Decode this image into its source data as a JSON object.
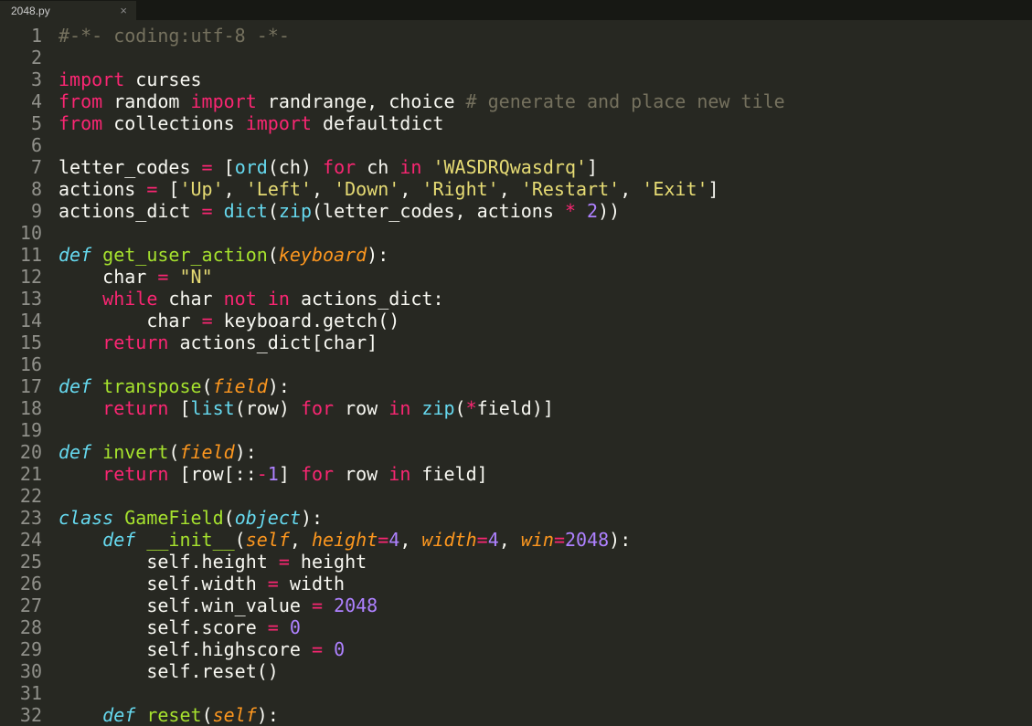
{
  "tab": {
    "filename": "2048.py",
    "close_glyph": "×"
  },
  "gutter": {
    "start": 1,
    "end": 32
  },
  "code": {
    "lines": [
      [
        {
          "cls": "c-comment",
          "t": "#-*- coding:utf-8 -*-"
        }
      ],
      [],
      [
        {
          "cls": "c-keyword",
          "t": "import"
        },
        {
          "cls": "c-name",
          "t": " curses"
        }
      ],
      [
        {
          "cls": "c-keyword",
          "t": "from"
        },
        {
          "cls": "c-name",
          "t": " random "
        },
        {
          "cls": "c-keyword",
          "t": "import"
        },
        {
          "cls": "c-name",
          "t": " randrange, choice "
        },
        {
          "cls": "c-comment",
          "t": "# generate and place new tile"
        }
      ],
      [
        {
          "cls": "c-keyword",
          "t": "from"
        },
        {
          "cls": "c-name",
          "t": " collections "
        },
        {
          "cls": "c-keyword",
          "t": "import"
        },
        {
          "cls": "c-name",
          "t": " defaultdict"
        }
      ],
      [],
      [
        {
          "cls": "c-name",
          "t": "letter_codes "
        },
        {
          "cls": "c-op",
          "t": "="
        },
        {
          "cls": "c-name",
          "t": " ["
        },
        {
          "cls": "c-builtin",
          "t": "ord"
        },
        {
          "cls": "c-name",
          "t": "(ch) "
        },
        {
          "cls": "c-keyword",
          "t": "for"
        },
        {
          "cls": "c-name",
          "t": " ch "
        },
        {
          "cls": "c-keyword",
          "t": "in"
        },
        {
          "cls": "c-name",
          "t": " "
        },
        {
          "cls": "c-string",
          "t": "'WASDRQwasdrq'"
        },
        {
          "cls": "c-name",
          "t": "]"
        }
      ],
      [
        {
          "cls": "c-name",
          "t": "actions "
        },
        {
          "cls": "c-op",
          "t": "="
        },
        {
          "cls": "c-name",
          "t": " ["
        },
        {
          "cls": "c-string",
          "t": "'Up'"
        },
        {
          "cls": "c-name",
          "t": ", "
        },
        {
          "cls": "c-string",
          "t": "'Left'"
        },
        {
          "cls": "c-name",
          "t": ", "
        },
        {
          "cls": "c-string",
          "t": "'Down'"
        },
        {
          "cls": "c-name",
          "t": ", "
        },
        {
          "cls": "c-string",
          "t": "'Right'"
        },
        {
          "cls": "c-name",
          "t": ", "
        },
        {
          "cls": "c-string",
          "t": "'Restart'"
        },
        {
          "cls": "c-name",
          "t": ", "
        },
        {
          "cls": "c-string",
          "t": "'Exit'"
        },
        {
          "cls": "c-name",
          "t": "]"
        }
      ],
      [
        {
          "cls": "c-name",
          "t": "actions_dict "
        },
        {
          "cls": "c-op",
          "t": "="
        },
        {
          "cls": "c-name",
          "t": " "
        },
        {
          "cls": "c-builtin",
          "t": "dict"
        },
        {
          "cls": "c-name",
          "t": "("
        },
        {
          "cls": "c-builtin",
          "t": "zip"
        },
        {
          "cls": "c-name",
          "t": "(letter_codes, actions "
        },
        {
          "cls": "c-op",
          "t": "*"
        },
        {
          "cls": "c-name",
          "t": " "
        },
        {
          "cls": "c-number",
          "t": "2"
        },
        {
          "cls": "c-name",
          "t": "))"
        }
      ],
      [],
      [
        {
          "cls": "c-storage",
          "t": "def"
        },
        {
          "cls": "c-name",
          "t": " "
        },
        {
          "cls": "c-func",
          "t": "get_user_action"
        },
        {
          "cls": "c-name",
          "t": "("
        },
        {
          "cls": "c-param",
          "t": "keyboard"
        },
        {
          "cls": "c-name",
          "t": "):"
        }
      ],
      [
        {
          "indent": 1
        },
        {
          "cls": "c-name",
          "t": "char "
        },
        {
          "cls": "c-op",
          "t": "="
        },
        {
          "cls": "c-name",
          "t": " "
        },
        {
          "cls": "c-string",
          "t": "\"N\""
        }
      ],
      [
        {
          "indent": 1
        },
        {
          "cls": "c-keyword",
          "t": "while"
        },
        {
          "cls": "c-name",
          "t": " char "
        },
        {
          "cls": "c-keyword",
          "t": "not"
        },
        {
          "cls": "c-name",
          "t": " "
        },
        {
          "cls": "c-keyword",
          "t": "in"
        },
        {
          "cls": "c-name",
          "t": " actions_dict:"
        }
      ],
      [
        {
          "indent": 2
        },
        {
          "cls": "c-name",
          "t": "char "
        },
        {
          "cls": "c-op",
          "t": "="
        },
        {
          "cls": "c-name",
          "t": " keyboard.getch()"
        }
      ],
      [
        {
          "indent": 1
        },
        {
          "cls": "c-keyword",
          "t": "return"
        },
        {
          "cls": "c-name",
          "t": " actions_dict[char]"
        }
      ],
      [],
      [
        {
          "cls": "c-storage",
          "t": "def"
        },
        {
          "cls": "c-name",
          "t": " "
        },
        {
          "cls": "c-func",
          "t": "transpose"
        },
        {
          "cls": "c-name",
          "t": "("
        },
        {
          "cls": "c-param",
          "t": "field"
        },
        {
          "cls": "c-name",
          "t": "):"
        }
      ],
      [
        {
          "indent": 1
        },
        {
          "cls": "c-keyword",
          "t": "return"
        },
        {
          "cls": "c-name",
          "t": " ["
        },
        {
          "cls": "c-builtin",
          "t": "list"
        },
        {
          "cls": "c-name",
          "t": "(row) "
        },
        {
          "cls": "c-keyword",
          "t": "for"
        },
        {
          "cls": "c-name",
          "t": " row "
        },
        {
          "cls": "c-keyword",
          "t": "in"
        },
        {
          "cls": "c-name",
          "t": " "
        },
        {
          "cls": "c-builtin",
          "t": "zip"
        },
        {
          "cls": "c-name",
          "t": "("
        },
        {
          "cls": "c-op",
          "t": "*"
        },
        {
          "cls": "c-name",
          "t": "field)]"
        }
      ],
      [],
      [
        {
          "cls": "c-storage",
          "t": "def"
        },
        {
          "cls": "c-name",
          "t": " "
        },
        {
          "cls": "c-func",
          "t": "invert"
        },
        {
          "cls": "c-name",
          "t": "("
        },
        {
          "cls": "c-param",
          "t": "field"
        },
        {
          "cls": "c-name",
          "t": "):"
        }
      ],
      [
        {
          "indent": 1
        },
        {
          "cls": "c-keyword",
          "t": "return"
        },
        {
          "cls": "c-name",
          "t": " [row[::"
        },
        {
          "cls": "c-op",
          "t": "-"
        },
        {
          "cls": "c-number",
          "t": "1"
        },
        {
          "cls": "c-name",
          "t": "] "
        },
        {
          "cls": "c-keyword",
          "t": "for"
        },
        {
          "cls": "c-name",
          "t": " row "
        },
        {
          "cls": "c-keyword",
          "t": "in"
        },
        {
          "cls": "c-name",
          "t": " field]"
        }
      ],
      [],
      [
        {
          "cls": "c-storage",
          "t": "class"
        },
        {
          "cls": "c-name",
          "t": " "
        },
        {
          "cls": "c-class",
          "t": "GameField"
        },
        {
          "cls": "c-name",
          "t": "("
        },
        {
          "cls": "c-inherit",
          "t": "object"
        },
        {
          "cls": "c-name",
          "t": "):"
        }
      ],
      [
        {
          "indent": 1
        },
        {
          "cls": "c-storage",
          "t": "def"
        },
        {
          "cls": "c-name",
          "t": " "
        },
        {
          "cls": "c-func",
          "t": "__init__"
        },
        {
          "cls": "c-name",
          "t": "("
        },
        {
          "cls": "c-param",
          "t": "self"
        },
        {
          "cls": "c-name",
          "t": ", "
        },
        {
          "cls": "c-param",
          "t": "height"
        },
        {
          "cls": "c-op",
          "t": "="
        },
        {
          "cls": "c-number",
          "t": "4"
        },
        {
          "cls": "c-name",
          "t": ", "
        },
        {
          "cls": "c-param",
          "t": "width"
        },
        {
          "cls": "c-op",
          "t": "="
        },
        {
          "cls": "c-number",
          "t": "4"
        },
        {
          "cls": "c-name",
          "t": ", "
        },
        {
          "cls": "c-param",
          "t": "win"
        },
        {
          "cls": "c-op",
          "t": "="
        },
        {
          "cls": "c-number",
          "t": "2048"
        },
        {
          "cls": "c-name",
          "t": "):"
        }
      ],
      [
        {
          "indent": 2
        },
        {
          "cls": "c-name",
          "t": "self.height "
        },
        {
          "cls": "c-op",
          "t": "="
        },
        {
          "cls": "c-name",
          "t": " height"
        }
      ],
      [
        {
          "indent": 2
        },
        {
          "cls": "c-name",
          "t": "self.width "
        },
        {
          "cls": "c-op",
          "t": "="
        },
        {
          "cls": "c-name",
          "t": " width"
        }
      ],
      [
        {
          "indent": 2
        },
        {
          "cls": "c-name",
          "t": "self.win_value "
        },
        {
          "cls": "c-op",
          "t": "="
        },
        {
          "cls": "c-name",
          "t": " "
        },
        {
          "cls": "c-number",
          "t": "2048"
        }
      ],
      [
        {
          "indent": 2
        },
        {
          "cls": "c-name",
          "t": "self.score "
        },
        {
          "cls": "c-op",
          "t": "="
        },
        {
          "cls": "c-name",
          "t": " "
        },
        {
          "cls": "c-number",
          "t": "0"
        }
      ],
      [
        {
          "indent": 2
        },
        {
          "cls": "c-name",
          "t": "self.highscore "
        },
        {
          "cls": "c-op",
          "t": "="
        },
        {
          "cls": "c-name",
          "t": " "
        },
        {
          "cls": "c-number",
          "t": "0"
        }
      ],
      [
        {
          "indent": 2
        },
        {
          "cls": "c-name",
          "t": "self.reset()"
        }
      ],
      [],
      [
        {
          "indent": 1
        },
        {
          "cls": "c-storage",
          "t": "def"
        },
        {
          "cls": "c-name",
          "t": " "
        },
        {
          "cls": "c-func",
          "t": "reset"
        },
        {
          "cls": "c-name",
          "t": "("
        },
        {
          "cls": "c-param",
          "t": "self"
        },
        {
          "cls": "c-name",
          "t": "):"
        }
      ]
    ]
  }
}
